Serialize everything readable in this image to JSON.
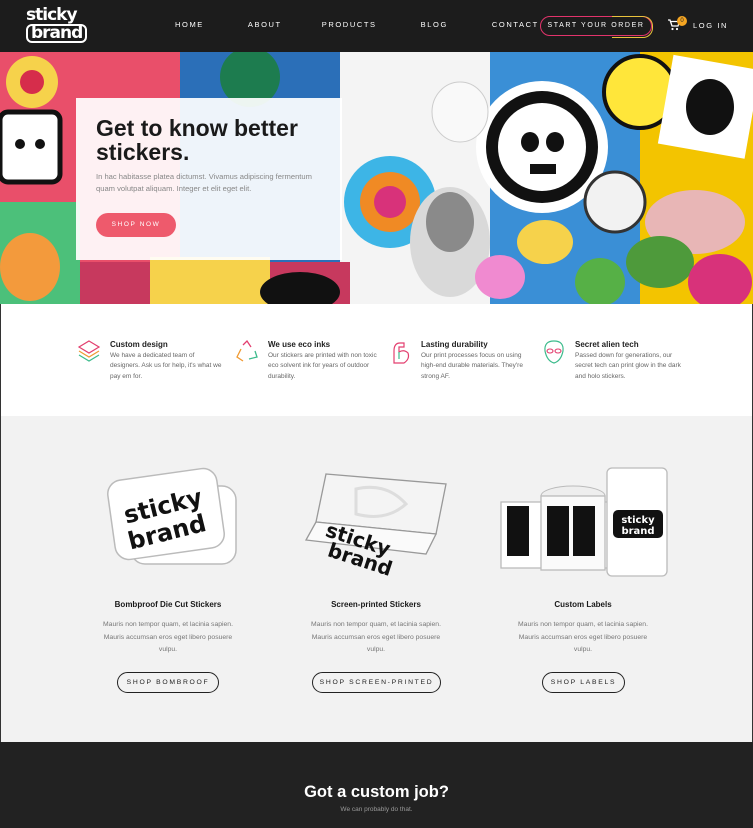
{
  "brand": {
    "line1": "sticky",
    "line2": "brand"
  },
  "nav": {
    "items": [
      "HOME",
      "ABOUT",
      "PRODUCTS",
      "BLOG",
      "CONTACT"
    ],
    "cta": "START YOUR ORDER",
    "cart_count": "0",
    "login": "LOG IN"
  },
  "hero": {
    "title": "Get to know better stickers.",
    "text": "In hac habitasse platea dictumst. Vivamus adipiscing fermentum quam volutpat aliquam. Integer et elit eget elit.",
    "button": "SHOP NOW"
  },
  "features": [
    {
      "icon": "layers-icon",
      "title": "Custom design",
      "text": "We have a dedicated team of designers. Ask us for help, it's what we pay em for."
    },
    {
      "icon": "recycle-icon",
      "title": "We use eco inks",
      "text": "Our stickers are printed with non toxic eco solvent ink for years of outdoor durability."
    },
    {
      "icon": "flexed-arm-icon",
      "title": "Lasting durability",
      "text": "Our print processes focus on using high-end durable materials. They're strong AF."
    },
    {
      "icon": "alien-icon",
      "title": "Secret alien tech",
      "text": "Passed down for generations, our secret tech can print glow in the dark and holo stickers."
    }
  ],
  "products": [
    {
      "title": "Bombproof Die Cut Stickers",
      "text": "Mauris non tempor quam, et lacinia sapien. Mauris accumsan eros eget libero posuere vulpu.",
      "button": "SHOP BOMBROOF"
    },
    {
      "title": "Screen-printed Stickers",
      "text": "Mauris non tempor quam, et lacinia sapien. Mauris accumsan eros eget libero posuere vulpu.",
      "button": "SHOP SCREEN-PRINTED"
    },
    {
      "title": "Custom Labels",
      "text": "Mauris non tempor quam, et lacinia sapien. Mauris accumsan eros eget libero posuere vulpu.",
      "button": "SHOP LABELS"
    }
  ],
  "custom_job": {
    "title": "Got a custom job?",
    "subtitle": "We can probably do that."
  },
  "colors": {
    "accent_pink": "#ee5a6c",
    "accent_yellow": "#e9c23c",
    "dark": "#1c1c1c"
  }
}
